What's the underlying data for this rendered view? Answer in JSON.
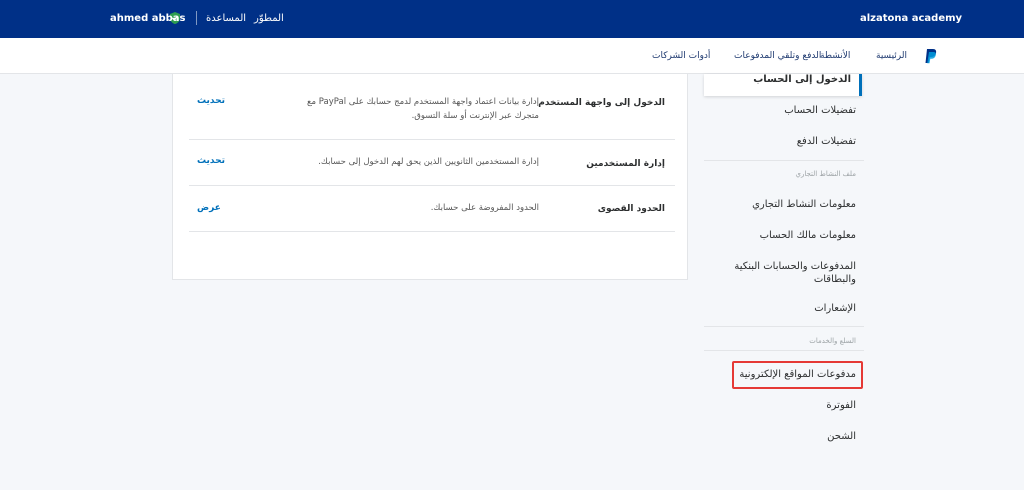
{
  "topbar": {
    "brand": "alzatona academy",
    "developer": "المطوّر",
    "help": "المساعدة",
    "username": "ahmed abbas"
  },
  "subnav": {
    "items": [
      "الرئيسية",
      "الأنشطة",
      "الدفع وتلقي المدفوعات",
      "أدوات الشركات"
    ]
  },
  "sidebar": {
    "active": "الدخول إلى الحساب",
    "items": [
      "تفضيلات الحساب",
      "تفضيلات الدفع"
    ],
    "section1": "ملف النشاط التجاري",
    "section1_items": [
      "معلومات النشاط التجاري",
      "معلومات مالك الحساب",
      "المدفوعات والحسابات البنكية والبطاقات",
      "الإشعارات"
    ],
    "section2": "السلع والخدمات",
    "section2_items": [
      "مدفوعات المواقع الإلكترونية",
      "الفوترة",
      "الشحن"
    ]
  },
  "rows": [
    {
      "title": "الدخول إلى واجهة المستخدم",
      "desc": "إدارة بيانات اعتماد واجهة المستخدم لدمج حسابك على PayPal مع متجرك عبر الإنترنت أو سلة التسوق.",
      "action": "تحديث"
    },
    {
      "title": "إدارة المستخدمين",
      "desc": "إدارة المستخدمين الثانويين الذين يحق لهم الدخول إلى حسابك.",
      "action": "تحديث"
    },
    {
      "title": "الحدود القصوى",
      "desc": "الحدود المفروضة على حسابك.",
      "action": "عرض"
    }
  ],
  "colors": {
    "topbar": "#003087",
    "link": "#0070ba",
    "highlight": "#e53935"
  },
  "icons": [
    "shield-check-icon",
    "paypal-logo-icon"
  ]
}
